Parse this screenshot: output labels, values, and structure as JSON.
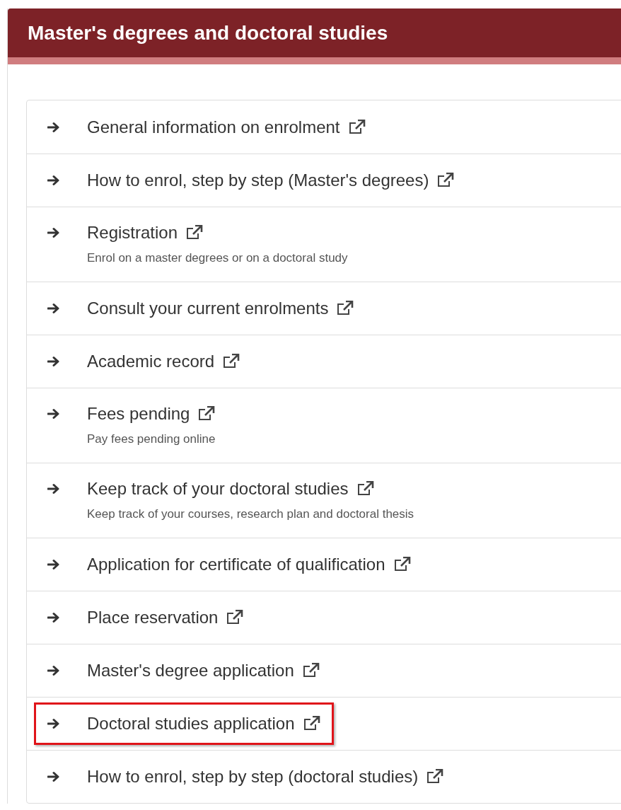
{
  "panel": {
    "title": "Master's degrees and doctoral studies"
  },
  "links": [
    {
      "label": "General information on enrolment",
      "highlighted": false
    },
    {
      "label": "How to enrol, step by step (Master's degrees)",
      "highlighted": false
    },
    {
      "label": "Registration",
      "description": "Enrol on a master degrees or on a doctoral study",
      "highlighted": false
    },
    {
      "label": "Consult your current enrolments",
      "highlighted": false
    },
    {
      "label": "Academic record",
      "highlighted": false
    },
    {
      "label": "Fees pending",
      "description": "Pay fees pending online",
      "highlighted": false
    },
    {
      "label": "Keep track of your doctoral studies",
      "description": "Keep track of your courses, research plan and doctoral thesis",
      "highlighted": false
    },
    {
      "label": "Application for certificate of qualification",
      "highlighted": false
    },
    {
      "label": "Place reservation",
      "highlighted": false
    },
    {
      "label": "Master's degree application",
      "highlighted": false
    },
    {
      "label": "Doctoral studies application",
      "highlighted": true
    },
    {
      "label": "How to enrol, step by step (doctoral studies)",
      "highlighted": false
    }
  ]
}
